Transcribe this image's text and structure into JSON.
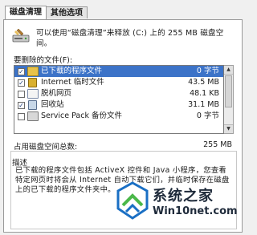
{
  "tabs": [
    {
      "label": "磁盘清理",
      "active": true
    },
    {
      "label": "其他选项",
      "active": false
    }
  ],
  "header": {
    "text": "可以使用“磁盘清理”来释放 (C:) 上的 255 MB 磁盘空间。"
  },
  "files_label": "要删除的文件(F):",
  "files": [
    {
      "checked": true,
      "name": "已下载的程序文件",
      "size": "0 字节",
      "selected": true,
      "icon": "folder-icon"
    },
    {
      "checked": true,
      "name": "Internet 临时文件",
      "size": "43.5 MB",
      "selected": false,
      "icon": "lock-icon"
    },
    {
      "checked": false,
      "name": "脱机网页",
      "size": "48.1 KB",
      "selected": false,
      "icon": "webpage-icon"
    },
    {
      "checked": true,
      "name": "回收站",
      "size": "31.1 MB",
      "selected": false,
      "icon": "recycle-bin-icon"
    },
    {
      "checked": false,
      "name": "Service Pack 备份文件",
      "size": "0 字节",
      "selected": false,
      "icon": "backup-icon"
    }
  ],
  "total": {
    "label": "占用磁盘空间总数:",
    "value": "255 MB"
  },
  "description": {
    "title": "描述",
    "text": "已下载的程序文件包括 ActiveX 控件和 Java 小程序，您查看特定网页时将会从 Internet 自动下载它们，并临时保存在磁盘上的已下载的程序文件夹中。"
  },
  "watermark": {
    "title": "系统之家",
    "url": "Win10net.com"
  },
  "colors": {
    "selection": "#3c73c8",
    "watermark_blue": "#1a6fc4",
    "watermark_green": "#4bb84a"
  }
}
